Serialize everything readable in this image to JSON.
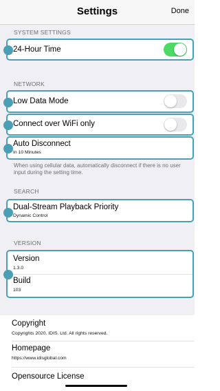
{
  "nav": {
    "title": "Settings",
    "done_label": "Done"
  },
  "sections": {
    "system": "SYSTEM SETTINGS",
    "network": "NETWORK",
    "search": "SEARCH",
    "version": "VERSION"
  },
  "system": {
    "hour24_label": "24-Hour Time",
    "hour24_on": true
  },
  "network": {
    "low_data_label": "Low Data Mode",
    "low_data_on": false,
    "wifi_only_label": "Connect over WiFi only",
    "wifi_only_on": false,
    "auto_disconnect_label": "Auto Disconnect",
    "auto_disconnect_value": "In 10 Minutes",
    "footnote": "When using cellular data, automatically disconnect if there is no user input during the setting time."
  },
  "search": {
    "dual_stream_label": "Dual-Stream Playback Priority",
    "dual_stream_value": "Dynamic Control"
  },
  "version": {
    "version_label": "Version",
    "version_value": "1.3.0",
    "build_label": "Build",
    "build_value": "103"
  },
  "about": {
    "copyright_label": "Copyright",
    "copyright_value": "Copyrights 2020. IDIS. Ltd. All rights reserved.",
    "homepage_label": "Homepage",
    "homepage_value": "https://www.idisglobal.com",
    "license_label": "Opensource License"
  },
  "colors": {
    "accent": "#4a9fb5",
    "toggle_on": "#4cd964",
    "toggle_off": "#e9e9eb",
    "background": "#efeff4"
  }
}
